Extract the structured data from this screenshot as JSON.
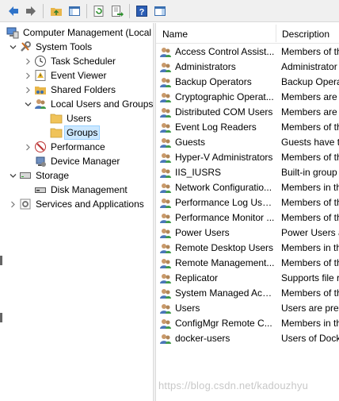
{
  "toolbar": {
    "buttons": [
      {
        "name": "back-arrow-icon"
      },
      {
        "name": "forward-arrow-icon"
      },
      {
        "name": "up-folder-icon"
      },
      {
        "name": "show-hide-console-tree-icon"
      },
      {
        "name": "refresh-icon"
      },
      {
        "name": "export-list-icon"
      },
      {
        "name": "help-icon"
      },
      {
        "name": "show-hide-action-pane-icon"
      }
    ]
  },
  "tree": {
    "root": "Computer Management (Local",
    "system_tools": "System Tools",
    "task_scheduler": "Task Scheduler",
    "event_viewer": "Event Viewer",
    "shared_folders": "Shared Folders",
    "local_users_groups": "Local Users and Groups",
    "users": "Users",
    "groups": "Groups",
    "performance": "Performance",
    "device_manager": "Device Manager",
    "storage": "Storage",
    "disk_management": "Disk Management",
    "services_apps": "Services and Applications"
  },
  "list": {
    "col_name": "Name",
    "col_description": "Description",
    "rows": [
      {
        "name": "Access Control Assist...",
        "desc": "Members of th"
      },
      {
        "name": "Administrators",
        "desc": "Administrator"
      },
      {
        "name": "Backup Operators",
        "desc": "Backup Opera"
      },
      {
        "name": "Cryptographic Operat...",
        "desc": "Members are"
      },
      {
        "name": "Distributed COM Users",
        "desc": "Members are"
      },
      {
        "name": "Event Log Readers",
        "desc": "Members of th"
      },
      {
        "name": "Guests",
        "desc": "Guests have th"
      },
      {
        "name": "Hyper-V Administrators",
        "desc": "Members of th"
      },
      {
        "name": "IIS_IUSRS",
        "desc": "Built-in group"
      },
      {
        "name": "Network Configuratio...",
        "desc": "Members in th"
      },
      {
        "name": "Performance Log Users",
        "desc": "Members of th"
      },
      {
        "name": "Performance Monitor ...",
        "desc": "Members of th"
      },
      {
        "name": "Power Users",
        "desc": "Power Users a"
      },
      {
        "name": "Remote Desktop Users",
        "desc": "Members in th"
      },
      {
        "name": "Remote Management...",
        "desc": "Members of th"
      },
      {
        "name": "Replicator",
        "desc": "Supports file r"
      },
      {
        "name": "System Managed Acc...",
        "desc": "Members of th"
      },
      {
        "name": "Users",
        "desc": "Users are prev"
      },
      {
        "name": "ConfigMgr Remote C...",
        "desc": "Members in th"
      },
      {
        "name": "docker-users",
        "desc": "Users of Dock"
      }
    ]
  },
  "watermark": "https://blog.csdn.net/kadouzhyu",
  "colors": {
    "selection": "#cce8ff",
    "toolbar": "#f0f0f0"
  }
}
